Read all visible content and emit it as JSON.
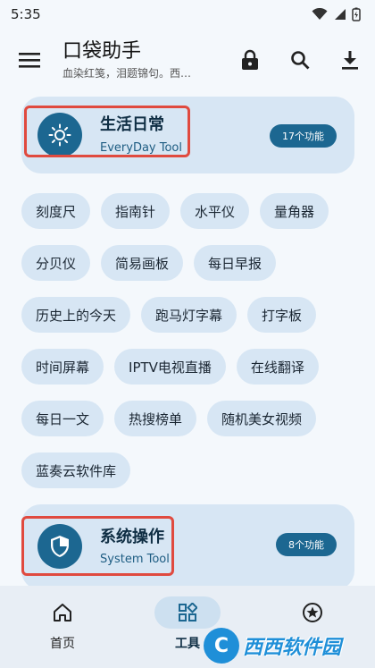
{
  "status": {
    "time": "5:35"
  },
  "app_bar": {
    "title": "口袋助手",
    "subtitle": "血染红笺，泪题锦句。西…"
  },
  "categories": [
    {
      "name": "生活日常",
      "en": "EveryDay Tool",
      "count": "17个功能",
      "icon": "brightness-icon"
    },
    {
      "name": "系统操作",
      "en": "System Tool",
      "count": "8个功能",
      "icon": "security-shield-icon"
    }
  ],
  "tools": [
    "刻度尺",
    "指南针",
    "水平仪",
    "量角器",
    "分贝仪",
    "简易画板",
    "每日早报",
    "历史上的今天",
    "跑马灯字幕",
    "打字板",
    "时间屏幕",
    "IPTV电视直播",
    "在线翻译",
    "每日一文",
    "热搜榜单",
    "随机美女视频",
    "蓝奏云软件库"
  ],
  "bottom_nav": [
    {
      "label": "首页",
      "icon": "home-icon",
      "active": false
    },
    {
      "label": "工具",
      "icon": "widgets-icon",
      "active": true
    },
    {
      "label": "",
      "icon": "star-badge-icon",
      "active": false
    }
  ],
  "watermark": {
    "logo": "C",
    "text": "西西软件园"
  },
  "colors": {
    "accent": "#1c6791",
    "card": "#d7e6f4",
    "highlight": "#e04a3f"
  }
}
